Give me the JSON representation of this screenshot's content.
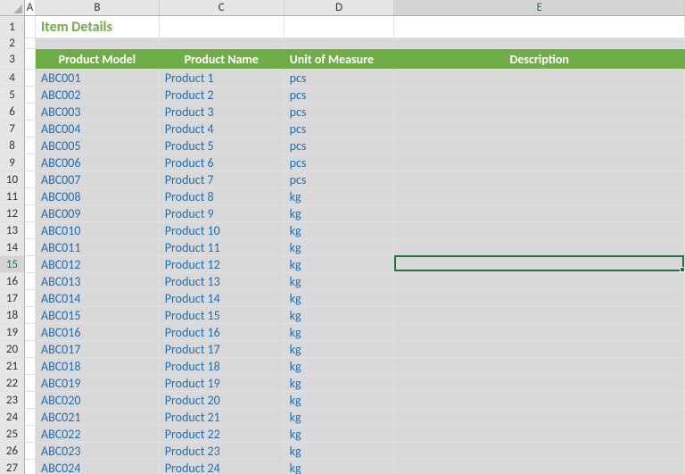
{
  "columns": [
    "A",
    "B",
    "C",
    "D",
    "E"
  ],
  "title": "Item Details",
  "table_headers": {
    "model": "Product Model",
    "name": "Product Name",
    "uom": "Unit of Measure",
    "desc": "Description"
  },
  "rows": [
    {
      "model": "ABC001",
      "name": "Product 1",
      "uom": "pcs",
      "desc": ""
    },
    {
      "model": "ABC002",
      "name": "Product 2",
      "uom": "pcs",
      "desc": ""
    },
    {
      "model": "ABC003",
      "name": "Product 3",
      "uom": "pcs",
      "desc": ""
    },
    {
      "model": "ABC004",
      "name": "Product 4",
      "uom": "pcs",
      "desc": ""
    },
    {
      "model": "ABC005",
      "name": "Product 5",
      "uom": "pcs",
      "desc": ""
    },
    {
      "model": "ABC006",
      "name": "Product 6",
      "uom": "pcs",
      "desc": ""
    },
    {
      "model": "ABC007",
      "name": "Product 7",
      "uom": "pcs",
      "desc": ""
    },
    {
      "model": "ABC008",
      "name": "Product 8",
      "uom": "kg",
      "desc": ""
    },
    {
      "model": "ABC009",
      "name": "Product 9",
      "uom": "kg",
      "desc": ""
    },
    {
      "model": "ABC010",
      "name": "Product 10",
      "uom": "kg",
      "desc": ""
    },
    {
      "model": "ABC011",
      "name": "Product 11",
      "uom": "kg",
      "desc": ""
    },
    {
      "model": "ABC012",
      "name": "Product 12",
      "uom": "kg",
      "desc": ""
    },
    {
      "model": "ABC013",
      "name": "Product 13",
      "uom": "kg",
      "desc": ""
    },
    {
      "model": "ABC014",
      "name": "Product 14",
      "uom": "kg",
      "desc": ""
    },
    {
      "model": "ABC015",
      "name": "Product 15",
      "uom": "kg",
      "desc": ""
    },
    {
      "model": "ABC016",
      "name": "Product 16",
      "uom": "kg",
      "desc": ""
    },
    {
      "model": "ABC017",
      "name": "Product 17",
      "uom": "kg",
      "desc": ""
    },
    {
      "model": "ABC018",
      "name": "Product 18",
      "uom": "kg",
      "desc": ""
    },
    {
      "model": "ABC019",
      "name": "Product 19",
      "uom": "kg",
      "desc": ""
    },
    {
      "model": "ABC020",
      "name": "Product 20",
      "uom": "kg",
      "desc": ""
    },
    {
      "model": "ABC021",
      "name": "Product 21",
      "uom": "kg",
      "desc": ""
    },
    {
      "model": "ABC022",
      "name": "Product 22",
      "uom": "kg",
      "desc": ""
    },
    {
      "model": "ABC023",
      "name": "Product 23",
      "uom": "kg",
      "desc": ""
    },
    {
      "model": "ABC024",
      "name": "Product 24",
      "uom": "kg",
      "desc": ""
    }
  ],
  "row_heights": {
    "title_row": 25,
    "blank_row": 12,
    "header_row": 23,
    "data_row": 19
  },
  "active_cell": {
    "col": "E",
    "row": 15
  },
  "col_widths": {
    "A": 12,
    "B": 139,
    "C": 140,
    "D": 124,
    "E": 326
  }
}
